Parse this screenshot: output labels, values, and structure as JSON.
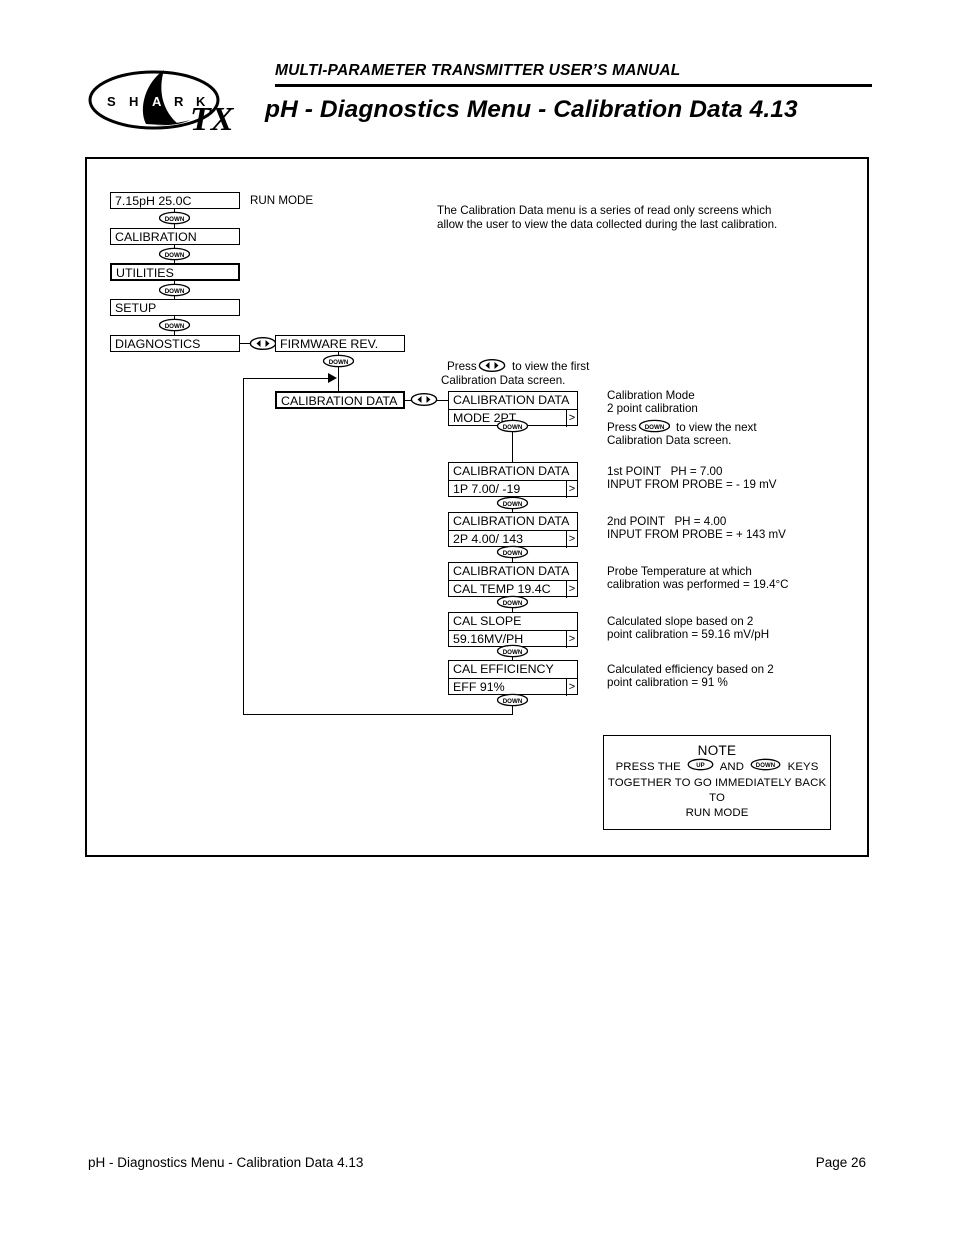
{
  "header": {
    "manual_title": "MULTI-PARAMETER TRANSMITTER USER’S MANUAL",
    "page_heading": "pH - Diagnostics Menu - Calibration Data 4.13",
    "logo_text": "SHARK",
    "logo_model": "TX"
  },
  "footer": {
    "left": "pH - Diagnostics Menu - Calibration Data 4.13",
    "right": "Page 26"
  },
  "keys": {
    "down": "DOWN",
    "up": "UP",
    "leftright": "◀▶"
  },
  "intro": {
    "line1": "The Calibration Data menu is a series of read only screens which",
    "line2": "allow the user to view the data collected during the last calibration."
  },
  "run_mode_label": "RUN MODE",
  "main_menu": [
    {
      "name": "run-mode-screen",
      "text": "7.15pH  25.0C",
      "thick": false
    },
    {
      "name": "calibration-screen",
      "text": "CALIBRATION",
      "thick": false
    },
    {
      "name": "utilities-screen",
      "text": "UTILITIES",
      "thick": true
    },
    {
      "name": "setup-screen",
      "text": "SETUP",
      "thick": false
    },
    {
      "name": "diagnostics-screen",
      "text": "DIAGNOSTICS",
      "thick": false
    }
  ],
  "firmware_rev_label": "FIRMWARE REV.",
  "calibration_data_label": "CALIBRATION DATA",
  "press_first": {
    "pre": "Press",
    "post": "to view the first",
    "line2": "Calibration Data screen."
  },
  "press_next": {
    "pre": "Press",
    "post": "to view the next",
    "line2": "Calibration Data screen."
  },
  "screens": [
    {
      "name": "mode-screen",
      "title": "CALIBRATION DATA",
      "value": "MODE 2PT",
      "cursor": ">",
      "note_line1": "Calibration Mode",
      "note_line2": "2 point calibration"
    },
    {
      "name": "point1-screen",
      "title": "CALIBRATION DATA",
      "value": "1P  7.00/  -19",
      "cursor": ">",
      "note_line1": "1st POINT   PH = 7.00",
      "note_line2": "INPUT FROM PROBE = - 19 mV"
    },
    {
      "name": "point2-screen",
      "title": "CALIBRATION DATA",
      "value": "2P  4.00/  143",
      "cursor": ">",
      "note_line1": "2nd POINT   PH = 4.00",
      "note_line2": "INPUT FROM PROBE = + 143 mV"
    },
    {
      "name": "cal-temp-screen",
      "title": "CALIBRATION DATA",
      "value": "CAL TEMP 19.4C",
      "cursor": ">",
      "note_line1": "Probe Temperature at which",
      "note_line2": "calibration was performed = 19.4°C"
    },
    {
      "name": "cal-slope-screen",
      "title": "CAL SLOPE",
      "value": " 59.16MV/PH",
      "cursor": ">",
      "note_line1": "Calculated slope based on 2",
      "note_line2": "point calibration = 59.16 mV/pH"
    },
    {
      "name": "cal-efficiency-screen",
      "title": "CAL EFFICIENCY",
      "value": "EFF   91%",
      "cursor": ">",
      "note_line1": "Calculated efficiency based on 2",
      "note_line2": "point calibration = 91 %"
    }
  ],
  "note": {
    "title": "NOTE",
    "l1_pre": "PRESS THE",
    "l1_mid": "AND",
    "l1_post": "KEYS",
    "l2": "TOGETHER TO GO IMMEDIATELY BACK TO",
    "l3": "RUN MODE"
  }
}
